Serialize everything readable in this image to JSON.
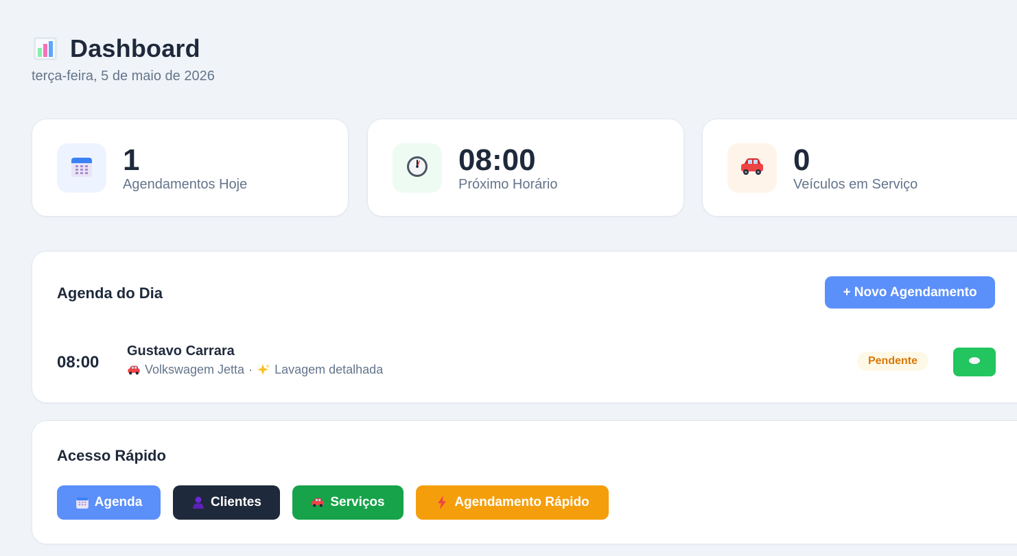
{
  "header": {
    "icon": "bar-chart-icon",
    "title": "Dashboard",
    "date": "terça-feira, 5 de maio de 2026"
  },
  "stats": [
    {
      "icon": "calendar-icon",
      "value": "1",
      "label": "Agendamentos Hoje"
    },
    {
      "icon": "clock-icon",
      "value": "08:00",
      "label": "Próximo Horário"
    },
    {
      "icon": "car-icon",
      "value": "0",
      "label": "Veículos em Serviço"
    }
  ],
  "agenda": {
    "title": "Agenda do Dia",
    "new_button": "+ Novo Agendamento",
    "appointments": [
      {
        "time": "08:00",
        "client": "Gustavo Carrara",
        "vehicle_icon": "car-icon",
        "vehicle": "Volkswagem Jetta",
        "separator": "·",
        "service_icon": "sparkles-icon",
        "service": "Lavagem detalhada",
        "status": "Pendente",
        "action_icon": "soap-icon"
      }
    ]
  },
  "quick_access": {
    "title": "Acesso Rápido",
    "buttons": [
      {
        "icon": "calendar-icon",
        "label": "Agenda"
      },
      {
        "icon": "person-icon",
        "label": "Clientes"
      },
      {
        "icon": "car-icon",
        "label": "Serviços"
      },
      {
        "icon": "lightning-icon",
        "label": "Agendamento Rápido"
      }
    ]
  },
  "colors": {
    "background": "#f0f4f8",
    "primary_blue": "#5b8ff9",
    "dark": "#1e293b",
    "green": "#16a34a",
    "bright_green": "#22c55e",
    "orange": "#f59e0b",
    "pending_text": "#d97706",
    "pending_bg": "#fef9e7",
    "muted_text": "#64748b"
  }
}
